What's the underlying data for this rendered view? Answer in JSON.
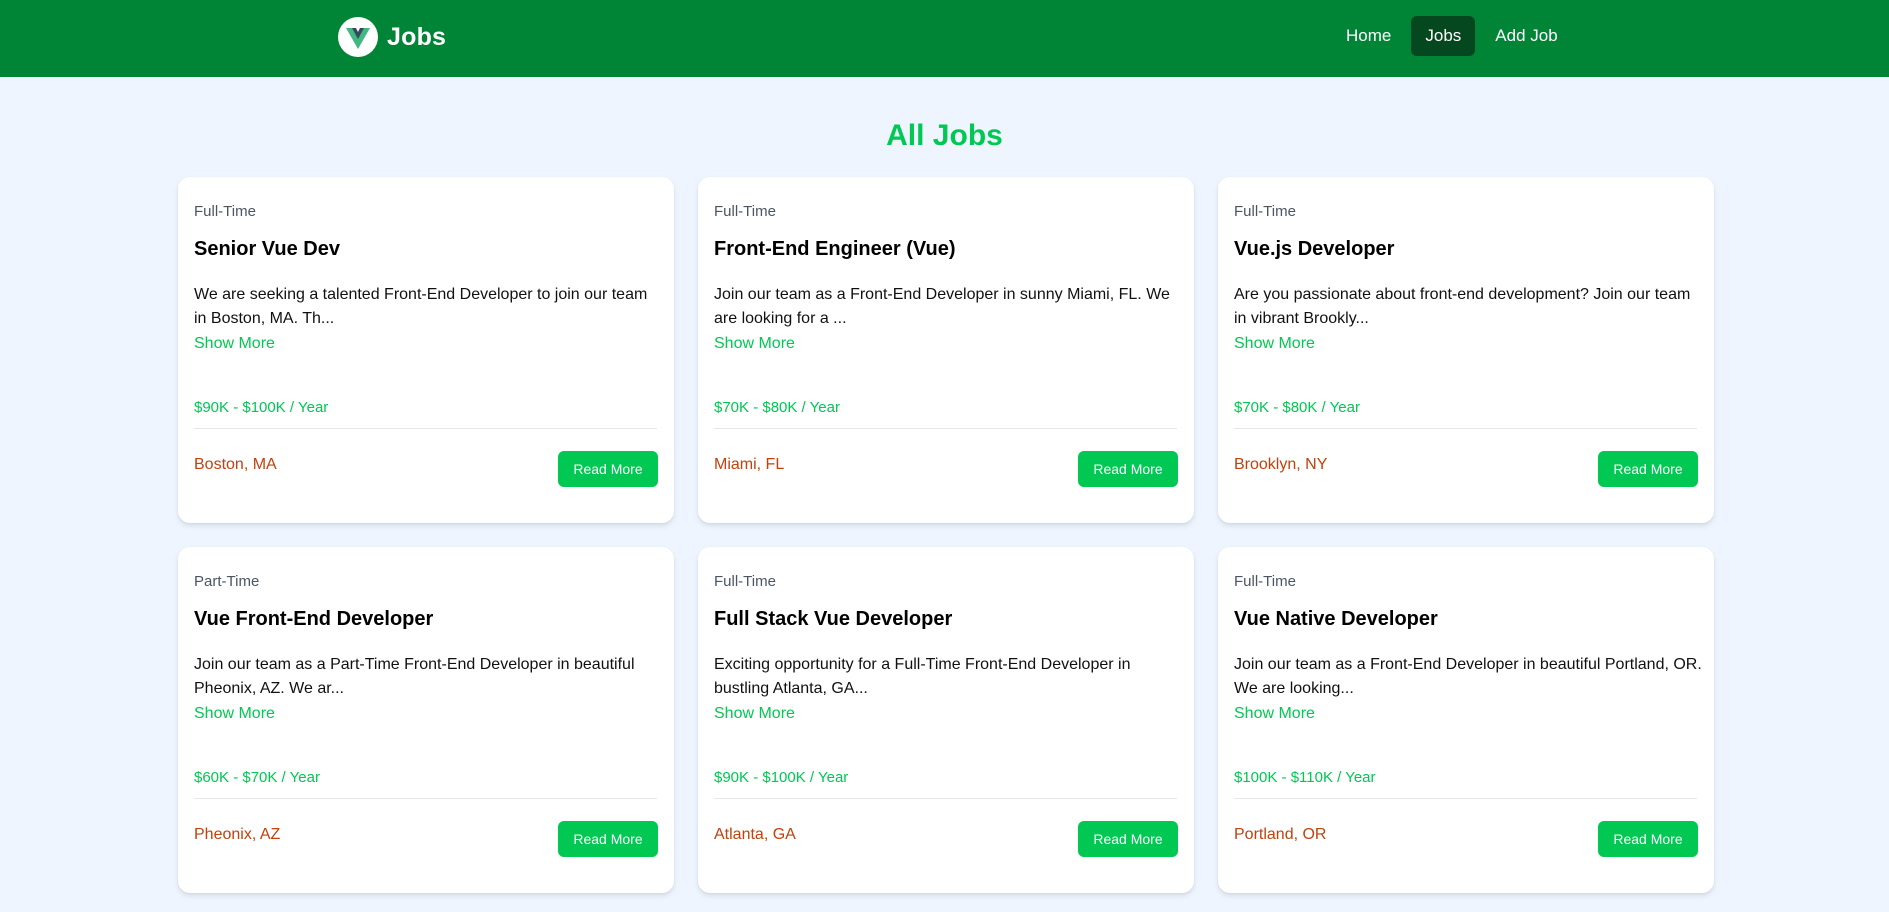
{
  "navbar": {
    "brand_title": "Jobs",
    "brand_icon": "vue-logo",
    "links": [
      {
        "label": "Home",
        "active": false
      },
      {
        "label": "Jobs",
        "active": true
      },
      {
        "label": "Add Job",
        "active": false
      }
    ]
  },
  "page_title": "All Jobs",
  "jobs": [
    {
      "type": "Full-Time",
      "title": "Senior Vue Dev",
      "description": "We are seeking a talented Front-End Developer to join our team in Boston, MA. Th...",
      "show_more": "Show More",
      "salary": "$90K - $100K / Year",
      "location": "Boston, MA",
      "button": "Read More"
    },
    {
      "type": "Full-Time",
      "title": "Front-End Engineer (Vue)",
      "description": "Join our team as a Front-End Developer in sunny Miami, FL. We are looking for a ...",
      "show_more": "Show More",
      "salary": "$70K - $80K / Year",
      "location": "Miami, FL",
      "button": "Read More"
    },
    {
      "type": "Full-Time",
      "title": "Vue.js Developer",
      "description": "Are you passionate about front-end development? Join our team in vibrant Brookly...",
      "show_more": "Show More",
      "salary": "$70K - $80K / Year",
      "location": "Brooklyn, NY",
      "button": "Read More"
    },
    {
      "type": "Part-Time",
      "title": "Vue Front-End Developer",
      "description": "Join our team as a Part-Time Front-End Developer in beautiful Pheonix, AZ. We ar...",
      "show_more": "Show More",
      "salary": "$60K - $70K / Year",
      "location": "Pheonix, AZ",
      "button": "Read More"
    },
    {
      "type": "Full-Time",
      "title": "Full Stack Vue Developer",
      "description": "Exciting opportunity for a Full-Time Front-End Developer in bustling Atlanta, GA...",
      "show_more": "Show More",
      "salary": "$90K - $100K / Year",
      "location": "Atlanta, GA",
      "button": "Read More"
    },
    {
      "type": "Full-Time",
      "title": "Vue Native Developer",
      "description": "Join our team as a Front-End Developer in beautiful Portland, OR. We are looking...",
      "show_more": "Show More",
      "salary": "$100K - $110K / Year",
      "location": "Portland, OR",
      "button": "Read More"
    }
  ],
  "colors": {
    "navbar_bg": "#008435",
    "nav_active_bg": "#05471f",
    "accent_green": "#00c853",
    "location_orange": "#c2410c",
    "page_bg": "#eef5ff"
  }
}
